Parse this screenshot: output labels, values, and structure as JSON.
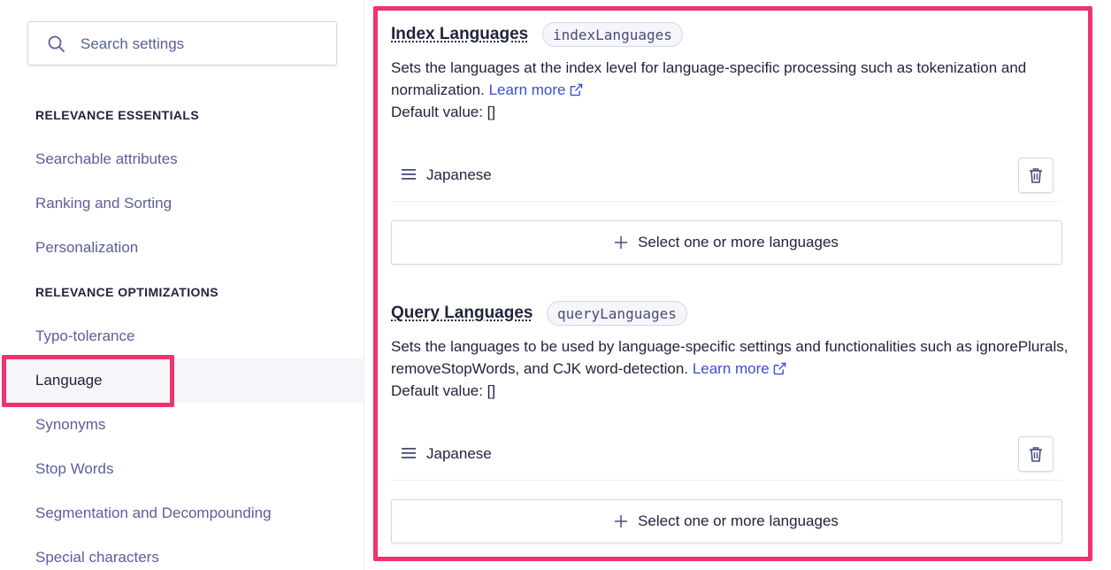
{
  "sidebar": {
    "search_placeholder": "Search settings",
    "groups": [
      {
        "heading": "RELEVANCE ESSENTIALS",
        "items": [
          "Searchable attributes",
          "Ranking and Sorting",
          "Personalization"
        ]
      },
      {
        "heading": "RELEVANCE OPTIMIZATIONS",
        "items": [
          "Typo-tolerance",
          "Language",
          "Synonyms",
          "Stop Words",
          "Segmentation and Decompounding",
          "Special characters"
        ]
      }
    ],
    "active_item": "Language"
  },
  "index_languages": {
    "title": "Index Languages",
    "code": "indexLanguages",
    "description": "Sets the languages at the index level for language-specific processing such as tokenization and normalization.",
    "learn_more": "Learn more",
    "default_value": "Default value: []",
    "languages": [
      "Japanese"
    ],
    "add_button": "Select one or more languages"
  },
  "query_languages": {
    "title": "Query Languages",
    "code": "queryLanguages",
    "description": "Sets the languages to be used by language-specific settings and functionalities such as ignorePlurals, removeStopWords, and CJK word-detection.",
    "learn_more": "Learn more",
    "default_value": "Default value: []",
    "languages": [
      "Japanese"
    ],
    "add_button": "Select one or more languages"
  },
  "colors": {
    "highlight": "#f0326d",
    "link": "#3a4fd1",
    "nav_text": "#5a5e9a",
    "active_bg": "#f5f5fa"
  }
}
